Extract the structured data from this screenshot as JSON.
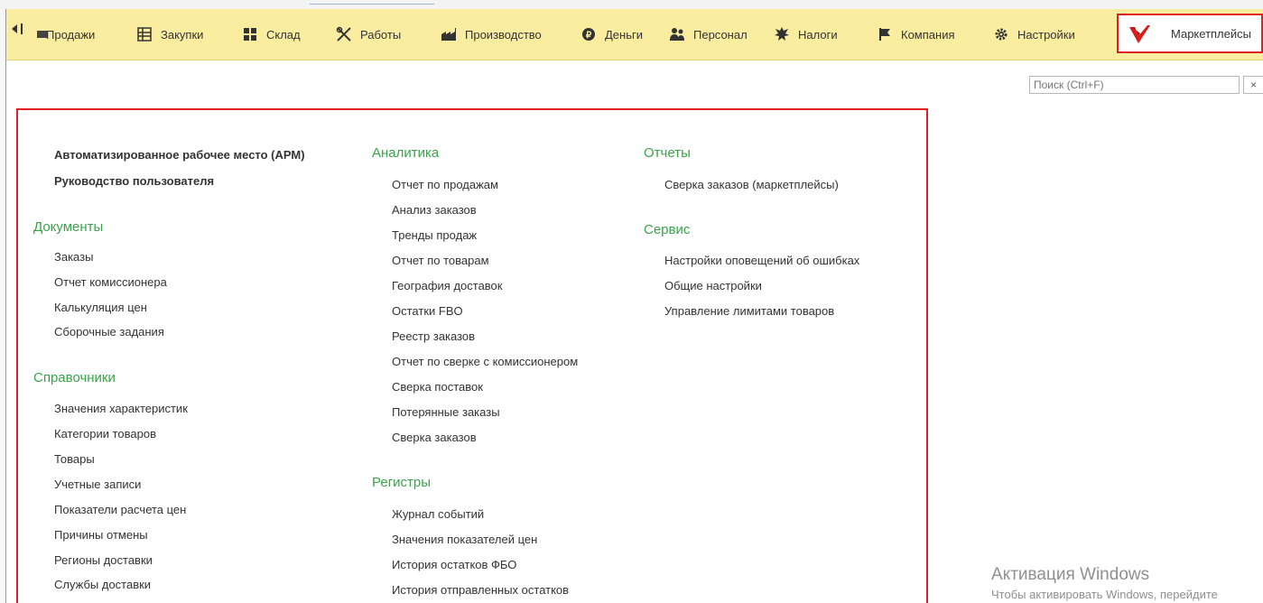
{
  "nav": {
    "items": [
      {
        "label": "Продажи",
        "icon": "sales-icon"
      },
      {
        "label": "Закупки",
        "icon": "purchases-icon"
      },
      {
        "label": "Склад",
        "icon": "warehouse-icon"
      },
      {
        "label": "Работы",
        "icon": "tools-icon"
      },
      {
        "label": "Производство",
        "icon": "production-icon"
      },
      {
        "label": "Деньги",
        "icon": "money-icon"
      },
      {
        "label": "Персонал",
        "icon": "staff-icon"
      },
      {
        "label": "Налоги",
        "icon": "taxes-icon"
      },
      {
        "label": "Компания",
        "icon": "flag-icon"
      },
      {
        "label": "Настройки",
        "icon": "gear-icon"
      },
      {
        "label": "Маркетплейсы",
        "icon": "marketplace-logo-icon",
        "active": true
      }
    ]
  },
  "search": {
    "placeholder": "Поиск (Ctrl+F)",
    "clear": "×"
  },
  "top_links": [
    "Автоматизированное рабочее место (АРМ)",
    "Руководство пользователя"
  ],
  "groups": {
    "documents": {
      "title": "Документы",
      "items": [
        "Заказы",
        "Отчет комиссионера",
        "Калькуляция цен",
        "Сборочные задания"
      ]
    },
    "references": {
      "title": "Справочники",
      "items": [
        "Значения характеристик",
        "Категории товаров",
        "Товары",
        "Учетные записи",
        "Показатели расчета цен",
        "Причины отмены",
        "Регионы доставки",
        "Службы доставки"
      ]
    },
    "analytics": {
      "title": "Аналитика",
      "items": [
        "Отчет по продажам",
        "Анализ заказов",
        "Тренды продаж",
        "Отчет по товарам",
        "География доставок",
        "Остатки FBO",
        "Реестр заказов",
        "Отчет по сверке с комиссионером",
        "Сверка поставок",
        "Потерянные заказы",
        "Сверка заказов"
      ]
    },
    "registers": {
      "title": "Регистры",
      "items": [
        "Журнал событий",
        "Значения показателей цен",
        "История остатков ФБО",
        "История отправленных остатков"
      ]
    },
    "reports": {
      "title": "Отчеты",
      "items": [
        "Сверка заказов (маркетплейсы)"
      ]
    },
    "service": {
      "title": "Сервис",
      "items": [
        "Настройки оповещений об ошибках",
        "Общие настройки",
        "Управление лимитами товаров"
      ]
    }
  },
  "watermark": {
    "line1": "Активация Windows",
    "line2": "Чтобы активировать Windows, перейдите"
  },
  "colors": {
    "accent_green": "#3aa34a",
    "topbar": "#fbeda0",
    "highlight": "#e02020"
  }
}
